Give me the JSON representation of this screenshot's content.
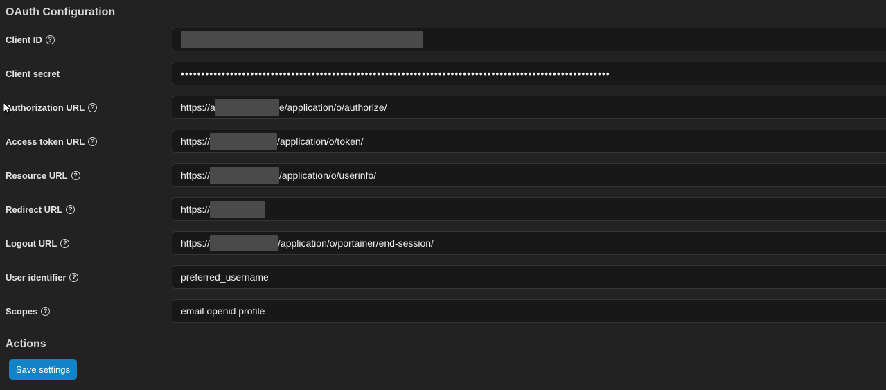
{
  "oauth": {
    "title": "OAuth Configuration",
    "fields": {
      "client_id": {
        "label": "Client ID",
        "value": ""
      },
      "client_secret": {
        "label": "Client secret",
        "value": "•••••••••••••••••••••••••••••••••••••••••••••••••••••••••••••••••••••••••••••••••••••••••••••••••••••••••"
      },
      "authorization_url": {
        "label": "Authorization URL",
        "prefix": "https://a",
        "suffix": "e/application/o/authorize/"
      },
      "access_token_url": {
        "label": "Access token URL",
        "prefix": "https://",
        "suffix": "/application/o/token/"
      },
      "resource_url": {
        "label": "Resource URL",
        "prefix": "https://",
        "suffix": "/application/o/userinfo/"
      },
      "redirect_url": {
        "label": "Redirect URL",
        "prefix": "https://",
        "suffix": ""
      },
      "logout_url": {
        "label": "Logout URL",
        "prefix": "https://",
        "suffix": "/application/o/portainer/end-session/"
      },
      "user_identifier": {
        "label": "User identifier",
        "value": "preferred_username"
      },
      "scopes": {
        "label": "Scopes",
        "value": "email openid profile"
      }
    },
    "help_icon_glyph": "?"
  },
  "actions": {
    "title": "Actions",
    "save_label": "Save settings"
  },
  "colors": {
    "background": "#222222",
    "field_background": "#181818",
    "field_border": "#353535",
    "accent": "#1183c6",
    "redaction": "#4a4a4a"
  },
  "icons": {
    "help": "question-circle-icon",
    "cursor": "mouse-pointer-icon"
  }
}
